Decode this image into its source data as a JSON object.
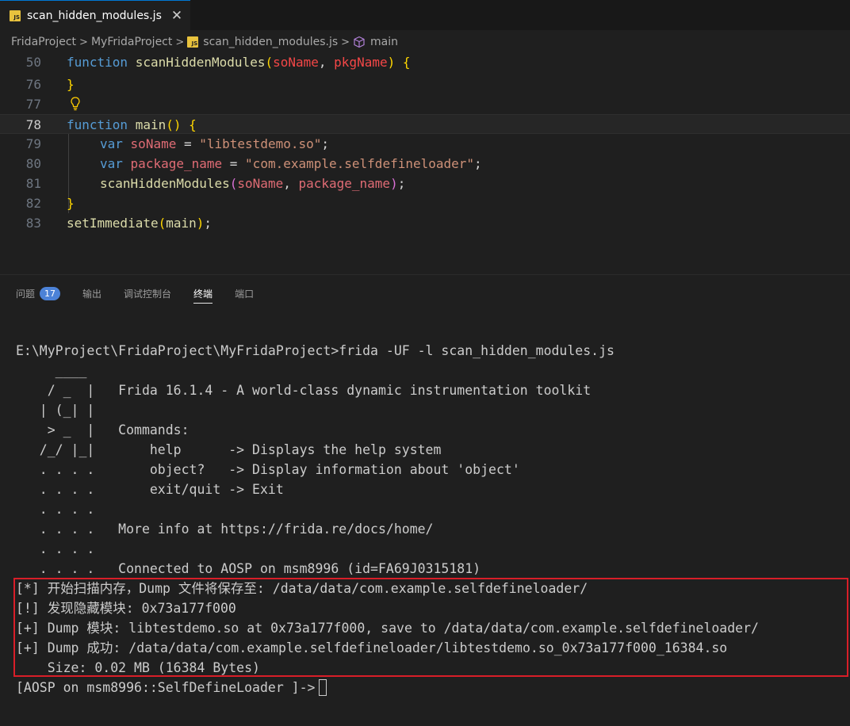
{
  "tab": {
    "icon": "js-file-icon",
    "label": "scan_hidden_modules.js",
    "close": "✕"
  },
  "breadcrumb": {
    "items": [
      "FridaProject",
      "MyFridaProject",
      "scan_hidden_modules.js",
      "main"
    ],
    "sep": ">"
  },
  "editor": {
    "lines": [
      {
        "num": "50",
        "current": false
      },
      {
        "num": "76",
        "current": false
      },
      {
        "num": "77",
        "current": false
      },
      {
        "num": "78",
        "current": true
      },
      {
        "num": "79",
        "current": false
      },
      {
        "num": "80",
        "current": false
      },
      {
        "num": "81",
        "current": false
      },
      {
        "num": "82",
        "current": false
      },
      {
        "num": "83",
        "current": false
      }
    ],
    "tokens": {
      "function": "function",
      "scanHiddenModules": "scanHiddenModules",
      "soName": "soName",
      "pkgName": "pkgName",
      "main": "main",
      "var": "var",
      "package_name": "package_name",
      "so_str": "\"libtestdemo.so\"",
      "pkg_str": "\"com.example.selfdefineloader\"",
      "setImmediate": "setImmediate",
      "open_paren": "(",
      "close_paren": ")",
      "open_brace": "{",
      "close_brace": "}",
      "comma_space": ", ",
      "eq": " = ",
      "semi": ";",
      "space": " "
    }
  },
  "panel": {
    "tabs": [
      {
        "label": "问题",
        "badge": "17"
      },
      {
        "label": "输出"
      },
      {
        "label": "调试控制台"
      },
      {
        "label": "终端",
        "active": true
      },
      {
        "label": "端口"
      }
    ]
  },
  "terminal": {
    "lines": [
      "E:\\MyProject\\FridaProject\\MyFridaProject>frida -UF -l scan_hidden_modules.js",
      "     ____",
      "    / _  |   Frida 16.1.4 - A world-class dynamic instrumentation toolkit",
      "   | (_| |",
      "    > _  |   Commands:",
      "   /_/ |_|       help      -> Displays the help system",
      "   . . . .       object?   -> Display information about 'object'",
      "   . . . .       exit/quit -> Exit",
      "   . . . .",
      "   . . . .   More info at https://frida.re/docs/home/",
      "   . . . .",
      "   . . . .   Connected to AOSP on msm8996 (id=FA69J0315181)",
      "[*] 开始扫描内存，Dump 文件将保存至: /data/data/com.example.selfdefineloader/",
      "[!] 发现隐藏模块: 0x73a177f000",
      "[+] Dump 模块: libtestdemo.so at 0x73a177f000, save to /data/data/com.example.selfdefineloader/",
      "[+] Dump 成功: /data/data/com.example.selfdefineloader/libtestdemo.so_0x73a177f000_16384.so",
      "    Size: 0.02 MB (16384 Bytes)",
      "[AOSP on msm8996::SelfDefineLoader ]->"
    ]
  },
  "colors": {
    "highlight_border": "#d81e28",
    "accent": "#0078d4",
    "badge": "#4c82d7"
  }
}
